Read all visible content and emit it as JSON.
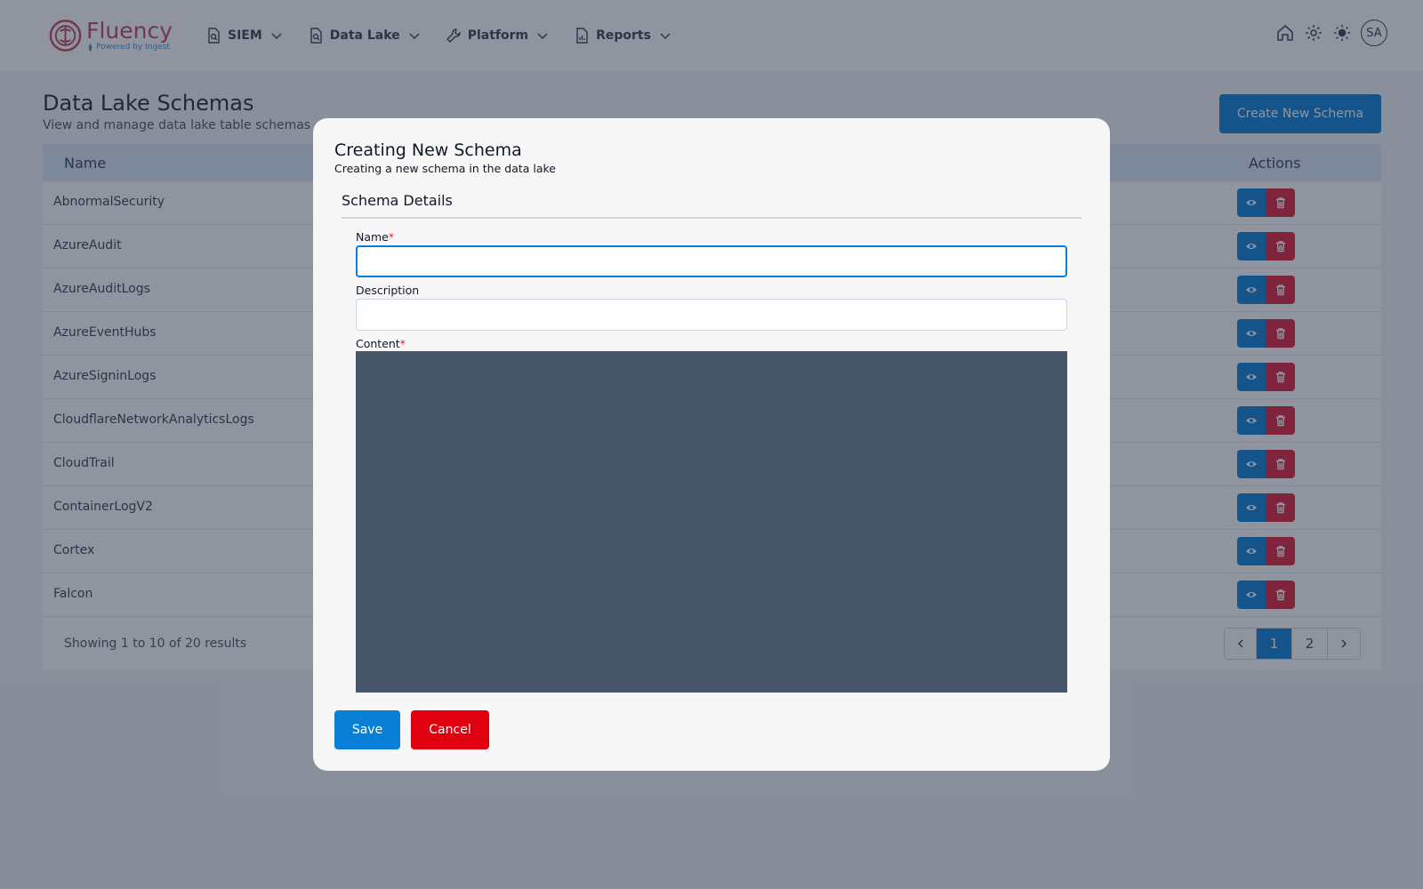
{
  "nav": {
    "logo_name": "Fluency",
    "logo_sub": "Powered by Ingest",
    "items": [
      {
        "label": "SIEM"
      },
      {
        "label": "Data Lake"
      },
      {
        "label": "Platform"
      },
      {
        "label": "Reports"
      }
    ],
    "avatar_initials": "SA"
  },
  "page": {
    "title": "Data Lake Schemas",
    "subtitle": "View and manage data lake table schemas",
    "create_button": "Create New Schema"
  },
  "table": {
    "columns": {
      "name": "Name",
      "actions": "Actions"
    },
    "rows": [
      {
        "name": "AbnormalSecurity"
      },
      {
        "name": "AzureAudit"
      },
      {
        "name": "AzureAuditLogs"
      },
      {
        "name": "AzureEventHubs"
      },
      {
        "name": "AzureSigninLogs"
      },
      {
        "name": "CloudflareNetworkAnalyticsLogs"
      },
      {
        "name": "CloudTrail"
      },
      {
        "name": "ContainerLogV2"
      },
      {
        "name": "Cortex"
      },
      {
        "name": "Falcon"
      }
    ],
    "showing": "Showing 1 to 10 of 20 results",
    "pagination": {
      "pages": [
        "1",
        "2"
      ],
      "current": "1"
    }
  },
  "modal": {
    "title": "Creating New Schema",
    "subtitle": "Creating a new schema in the data lake",
    "section": "Schema Details",
    "fields": {
      "name_label": "Name",
      "name_value": "",
      "description_label": "Description",
      "description_value": "",
      "content_label": "Content",
      "required_mark": "*"
    },
    "save_label": "Save",
    "cancel_label": "Cancel"
  },
  "colors": {
    "primary": "#0a7fd6",
    "danger": "#e01e36",
    "brand": "#c2455e",
    "editor_bg": "#475569"
  },
  "icons": {
    "nav": [
      "file-search-icon",
      "file-search-icon",
      "wrench-icon",
      "file-chart-icon"
    ],
    "right": [
      "home-icon",
      "gear-icon",
      "sun-icon"
    ],
    "row_actions": [
      "eye-icon",
      "trash-icon"
    ]
  }
}
